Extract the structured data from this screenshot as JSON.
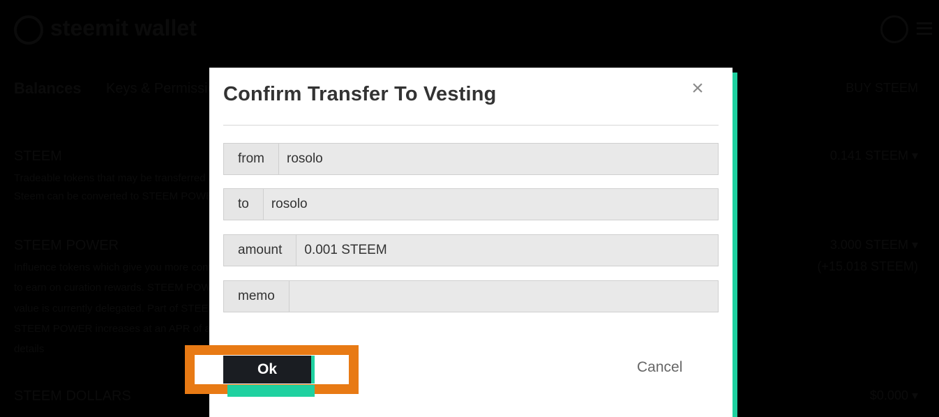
{
  "background": {
    "logo": "steemit wallet",
    "tabs": [
      "Balances",
      "Keys & Permissions"
    ],
    "tab_right": "BUY STEEM",
    "sections": [
      {
        "title": "STEEM",
        "desc": [
          "Tradeable tokens that may be transferred anywhere at anytime.",
          "Steem can be converted to STEEM POWER in a process called powering up."
        ],
        "value": "0.141 STEEM ▾"
      },
      {
        "title": "STEEM POWER",
        "desc": [
          "Influence tokens which give you more control over post payouts and allow you",
          "to earn on curation rewards. STEEM POWER is non-transferable and its",
          "value is currently delegated. Part of STEEM POWER may be delegated",
          "STEEM POWER increases at an APR of approximately",
          "details"
        ],
        "value": "3.000 STEEM ▾",
        "value2": "(+15.018 STEEM)"
      },
      {
        "title": "STEEM DOLLARS",
        "desc": [],
        "value": "$0.000 ▾"
      }
    ]
  },
  "modal": {
    "title": "Confirm Transfer To Vesting",
    "close_icon": "×",
    "fields": [
      {
        "label": "from",
        "value": "rosolo"
      },
      {
        "label": "to",
        "value": "rosolo"
      },
      {
        "label": "amount",
        "value": "0.001 STEEM"
      },
      {
        "label": "memo",
        "value": ""
      }
    ],
    "ok_label": "Ok",
    "cancel_label": "Cancel"
  },
  "colors": {
    "accent": "#1fd1a0",
    "highlight": "#e87a14",
    "button_dark": "#1a1d22"
  }
}
